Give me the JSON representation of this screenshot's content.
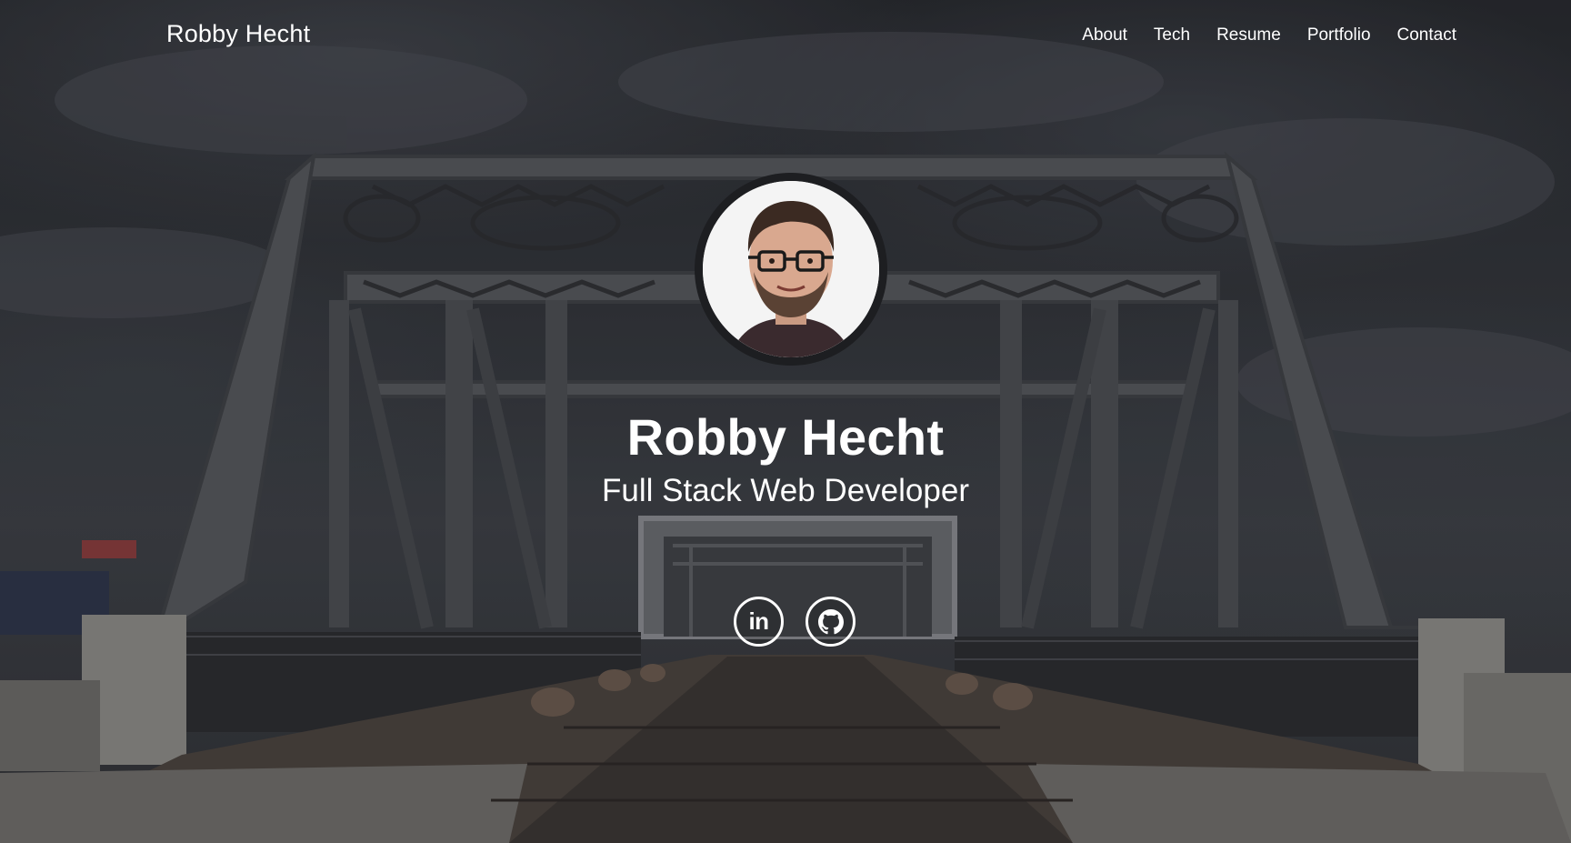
{
  "nav": {
    "brand": "Robby Hecht",
    "links": [
      {
        "label": "About"
      },
      {
        "label": "Tech"
      },
      {
        "label": "Resume"
      },
      {
        "label": "Portfolio"
      },
      {
        "label": "Contact"
      }
    ]
  },
  "hero": {
    "name": "Robby Hecht",
    "title": "Full Stack Web Developer",
    "background": "steel truss bridge under cloudy sky",
    "avatar": "headshot-photo"
  },
  "socials": [
    {
      "icon": "linkedin-icon",
      "glyph": "in"
    },
    {
      "icon": "github-icon"
    }
  ],
  "colors": {
    "text": "#ffffff",
    "overlay": "#2b2d31"
  }
}
